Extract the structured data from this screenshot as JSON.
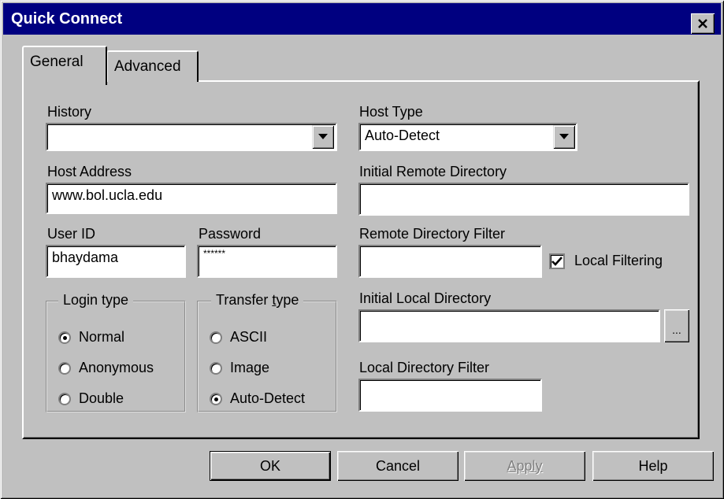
{
  "window": {
    "title": "Quick Connect"
  },
  "tabs": [
    {
      "label": "General",
      "active": true
    },
    {
      "label": "Advanced",
      "active": false
    }
  ],
  "history": {
    "label": "History",
    "value": ""
  },
  "host_address": {
    "label": "Host Address",
    "value": "www.bol.ucla.edu"
  },
  "user_id": {
    "label": "User ID",
    "value": "bhaydama"
  },
  "password": {
    "label": "Password",
    "value": "******"
  },
  "login_type": {
    "legend": "Login type",
    "options": [
      "Normal",
      "Anonymous",
      "Double"
    ],
    "selected": "Normal"
  },
  "transfer_type": {
    "legend_prefix": "Transfer ",
    "legend_underlined": "t",
    "legend_suffix": "ype",
    "options": [
      "ASCII",
      "Image",
      "Auto-Detect"
    ],
    "selected": "Auto-Detect"
  },
  "host_type": {
    "label": "Host Type",
    "value": "Auto-Detect"
  },
  "initial_remote_directory": {
    "label": "Initial Remote Directory",
    "value": ""
  },
  "remote_directory_filter": {
    "label": "Remote Directory Filter",
    "value": ""
  },
  "local_filtering": {
    "label": "Local Filtering",
    "checked": true
  },
  "initial_local_directory": {
    "label": "Initial Local Directory",
    "value": "",
    "browse_label": "..."
  },
  "local_directory_filter": {
    "label": "Local Directory Filter",
    "value": ""
  },
  "buttons": {
    "ok": "OK",
    "cancel": "Cancel",
    "apply": "Apply",
    "help": "Help"
  },
  "icons": {
    "close": "close-icon",
    "dropdown": "chevron-down-icon",
    "check": "checkmark-icon"
  }
}
